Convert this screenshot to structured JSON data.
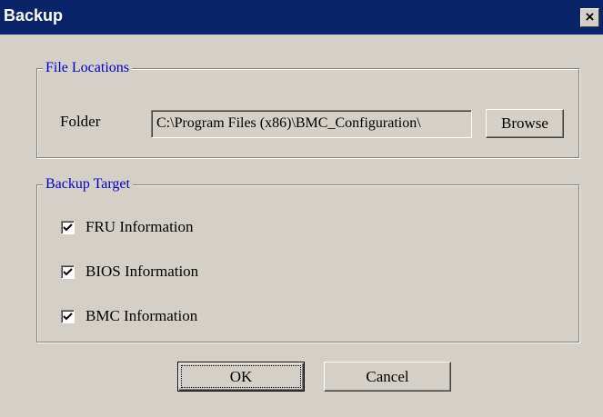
{
  "window": {
    "title": "Backup",
    "close_icon": "close-icon",
    "close_glyph": "×"
  },
  "file_locations": {
    "legend": "File Locations",
    "folder_label": "Folder",
    "folder_value": "C:\\Program Files (x86)\\BMC_Configuration\\",
    "browse_label": "Browse"
  },
  "backup_target": {
    "legend": "Backup Target",
    "items": [
      {
        "label": "FRU Information",
        "checked": true
      },
      {
        "label": "BIOS Information",
        "checked": true
      },
      {
        "label": "BMC Information",
        "checked": true
      }
    ]
  },
  "buttons": {
    "ok_label": "OK",
    "cancel_label": "Cancel"
  },
  "colors": {
    "title_bar": "#0a246a",
    "group_legend": "#0000c8",
    "dialog_face": "#d4d0c8"
  }
}
